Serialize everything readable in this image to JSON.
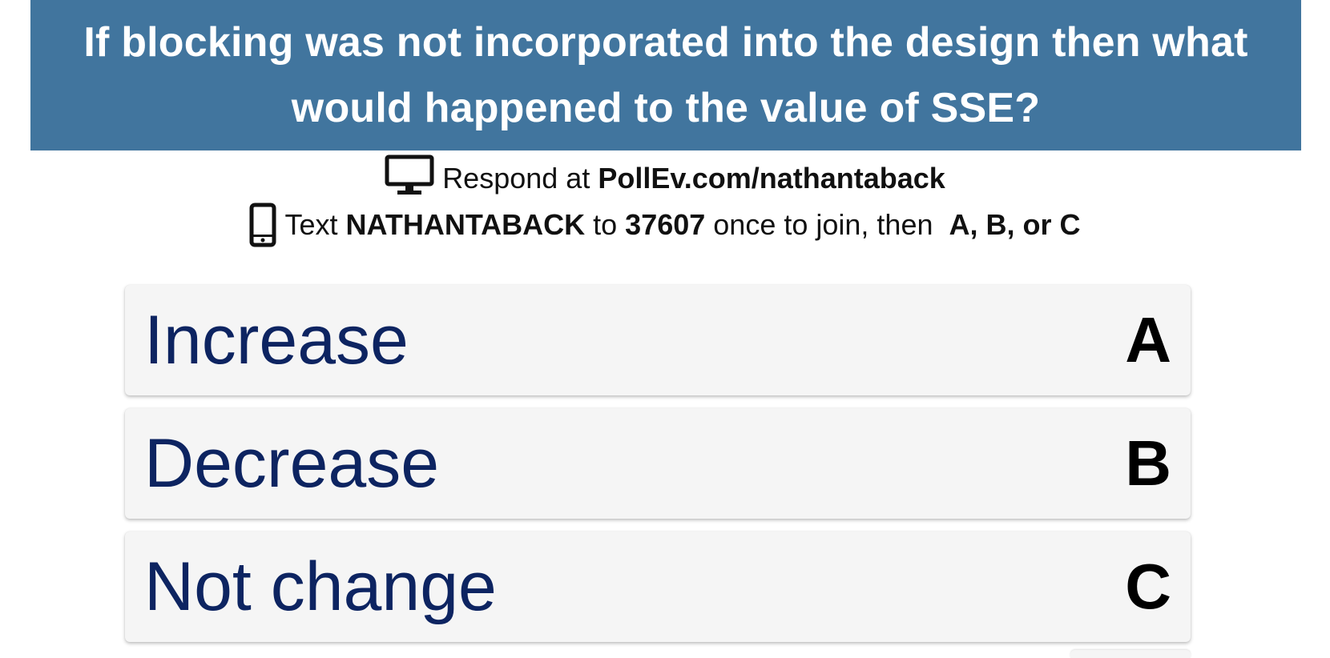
{
  "question": {
    "text": "If blocking was not incorporated into the design then what would happened to the value of SSE?"
  },
  "instructions": {
    "web": {
      "icon": "monitor-icon",
      "prefix": "Respond at",
      "url": "PollEv.com/nathantaback"
    },
    "text": {
      "icon": "phone-icon",
      "prefix": "Text",
      "keyword": "NATHANTABACK",
      "to": "to",
      "number": "37607",
      "suffix": "once to join, then",
      "choices": "A, B, or C"
    }
  },
  "options": [
    {
      "label": "Increase",
      "key": "A"
    },
    {
      "label": "Decrease",
      "key": "B"
    },
    {
      "label": "Not change",
      "key": "C"
    }
  ],
  "colors": {
    "banner": "#41759e",
    "option_text": "#0d2461",
    "option_bg": "#f5f5f5"
  }
}
